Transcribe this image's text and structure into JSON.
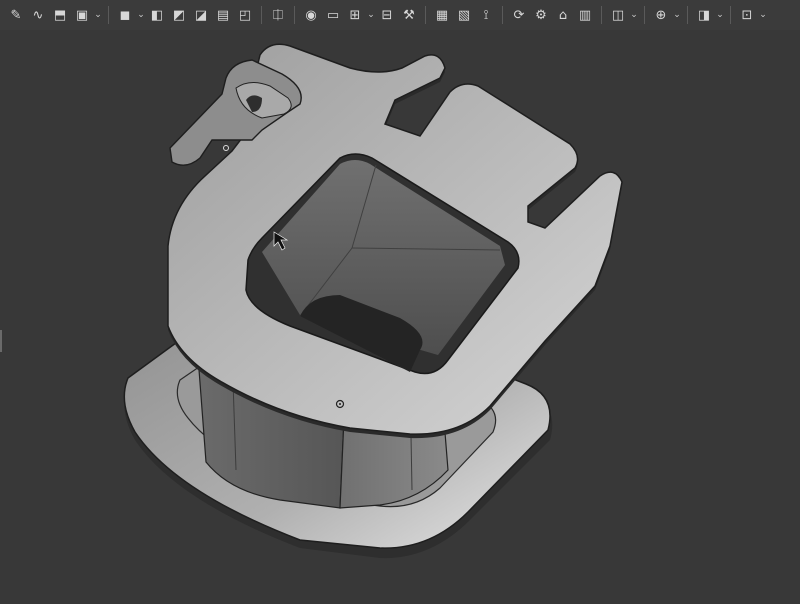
{
  "toolbar": {
    "groups": [
      [
        {
          "icon": "sketch-icon"
        },
        {
          "icon": "spline-icon"
        },
        {
          "icon": "extrude-icon"
        },
        {
          "icon": "box-icon",
          "dropdown": true
        }
      ],
      [
        {
          "icon": "solid-icon",
          "dropdown": true
        },
        {
          "icon": "face-icon"
        },
        {
          "icon": "sweep-icon"
        },
        {
          "icon": "boss-icon"
        },
        {
          "icon": "shell-icon"
        },
        {
          "icon": "fillet-icon"
        }
      ],
      [
        {
          "icon": "mirror-icon"
        }
      ],
      [
        {
          "icon": "sphere-icon"
        },
        {
          "icon": "cylinder-icon"
        },
        {
          "icon": "pattern-icon",
          "dropdown": true
        },
        {
          "icon": "split-icon"
        },
        {
          "icon": "tool-icon"
        }
      ],
      [
        {
          "icon": "grid-icon"
        },
        {
          "icon": "hatch-icon"
        },
        {
          "icon": "measure-icon"
        }
      ],
      [
        {
          "icon": "rotate-icon"
        },
        {
          "icon": "gear-icon"
        },
        {
          "icon": "render-icon"
        },
        {
          "icon": "material-icon"
        }
      ],
      [
        {
          "icon": "view-cube-icon",
          "dropdown": true
        }
      ],
      [
        {
          "icon": "snap-icon",
          "dropdown": true
        }
      ],
      [
        {
          "icon": "section-icon",
          "dropdown": true
        }
      ],
      [
        {
          "icon": "display-icon",
          "dropdown": true
        }
      ]
    ],
    "icon_glyphs": {
      "sketch-icon": "✎",
      "spline-icon": "∿",
      "extrude-icon": "⬒",
      "box-icon": "▣",
      "solid-icon": "◼",
      "face-icon": "◧",
      "sweep-icon": "◩",
      "boss-icon": "◪",
      "shell-icon": "▤",
      "fillet-icon": "◰",
      "mirror-icon": "⎅",
      "sphere-icon": "◉",
      "cylinder-icon": "▭",
      "pattern-icon": "⊞",
      "split-icon": "⊟",
      "tool-icon": "⚒",
      "grid-icon": "▦",
      "hatch-icon": "▧",
      "measure-icon": "⟟",
      "rotate-icon": "⟳",
      "gear-icon": "⚙",
      "render-icon": "⌂",
      "material-icon": "▥",
      "view-cube-icon": "◫",
      "snap-icon": "⊕",
      "section-icon": "◨",
      "display-icon": "⊡"
    },
    "dropdown_glyph": "⌄"
  },
  "viewport": {
    "background": "#383838",
    "model_color": "#b9b9b9",
    "edge_color": "#1e1e1e"
  }
}
